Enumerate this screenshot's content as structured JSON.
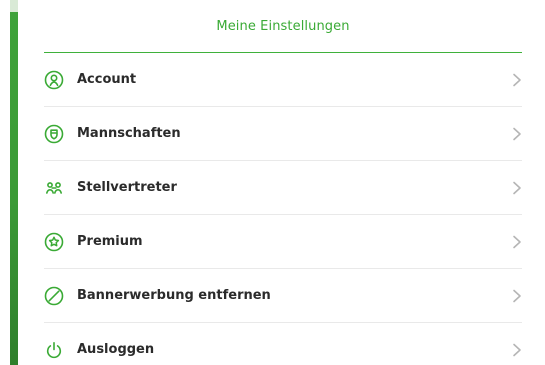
{
  "header": {
    "title": "Meine Einstellungen"
  },
  "menu": {
    "items": [
      {
        "label": "Account",
        "icon": "account-icon"
      },
      {
        "label": "Mannschaften",
        "icon": "shield-icon"
      },
      {
        "label": "Stellvertreter",
        "icon": "people-icon"
      },
      {
        "label": "Premium",
        "icon": "star-icon"
      },
      {
        "label": "Bannerwerbung entfernen",
        "icon": "block-icon"
      },
      {
        "label": "Ausloggen",
        "icon": "power-icon"
      }
    ]
  },
  "colors": {
    "accent": "#3aaa35",
    "text": "#2b2b2b",
    "divider": "#e9e9e9",
    "chevron": "#b5b5b5"
  }
}
